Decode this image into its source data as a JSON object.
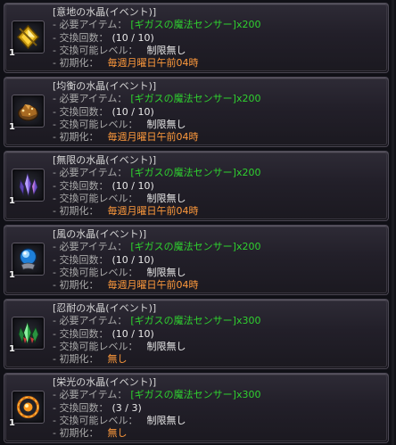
{
  "items": [
    {
      "name": "[意地の水晶(イベント)]",
      "icon": "yellow-diamond-crystal-icon",
      "quantity": "1",
      "required_label": "- 必要アイテム：",
      "required_item": "[ギガスの魔法センサー]",
      "required_qty": "x200",
      "exchange_label": "- 交換回数：",
      "exchange_value": "(10 / 10)",
      "level_label": "- 交換可能レベル：",
      "level_value": "制限無し",
      "reset_label": "- 初期化：",
      "reset_value": "毎週月曜日午前04時"
    },
    {
      "name": "[均衡の水晶(イベント)]",
      "icon": "brown-ore-crystal-icon",
      "quantity": "1",
      "required_label": "- 必要アイテム：",
      "required_item": "[ギガスの魔法センサー]",
      "required_qty": "x200",
      "exchange_label": "- 交換回数：",
      "exchange_value": "(10 / 10)",
      "level_label": "- 交換可能レベル：",
      "level_value": "制限無し",
      "reset_label": "- 初期化：",
      "reset_value": "毎週月曜日午前04時"
    },
    {
      "name": "[無限の水晶(イベント)]",
      "icon": "purple-crystal-cluster-icon",
      "quantity": "1",
      "required_label": "- 必要アイテム：",
      "required_item": "[ギガスの魔法センサー]",
      "required_qty": "x200",
      "exchange_label": "- 交換回数：",
      "exchange_value": "(10 / 10)",
      "level_label": "- 交換可能レベル：",
      "level_value": "制限無し",
      "reset_label": "- 初期化：",
      "reset_value": "毎週月曜日午前04時"
    },
    {
      "name": "[風の水晶(イベント)]",
      "icon": "blue-orb-crystal-icon",
      "quantity": "1",
      "required_label": "- 必要アイテム：",
      "required_item": "[ギガスの魔法センサー]",
      "required_qty": "x200",
      "exchange_label": "- 交換回数：",
      "exchange_value": "(10 / 10)",
      "level_label": "- 交換可能レベル：",
      "level_value": "制限無し",
      "reset_label": "- 初期化：",
      "reset_value": "毎週月曜日午前04時"
    },
    {
      "name": "[忍耐の水晶(イベント)]",
      "icon": "green-crystal-cluster-icon",
      "quantity": "1",
      "required_label": "- 必要アイテム：",
      "required_item": "[ギガスの魔法センサー]",
      "required_qty": "x300",
      "exchange_label": "- 交換回数：",
      "exchange_value": "(10 / 10)",
      "level_label": "- 交換可能レベル：",
      "level_value": "制限無し",
      "reset_label": "- 初期化：",
      "reset_value": "無し"
    },
    {
      "name": "[栄光の水晶(イベント)]",
      "icon": "orange-ring-crystal-icon",
      "quantity": "1",
      "required_label": "- 必要アイテム：",
      "required_item": "[ギガスの魔法センサー]",
      "required_qty": "x300",
      "exchange_label": "- 交換回数：",
      "exchange_value": "(3 / 3)",
      "level_label": "- 交換可能レベル：",
      "level_value": "制限無し",
      "reset_label": "- 初期化：",
      "reset_value": "無し"
    }
  ]
}
